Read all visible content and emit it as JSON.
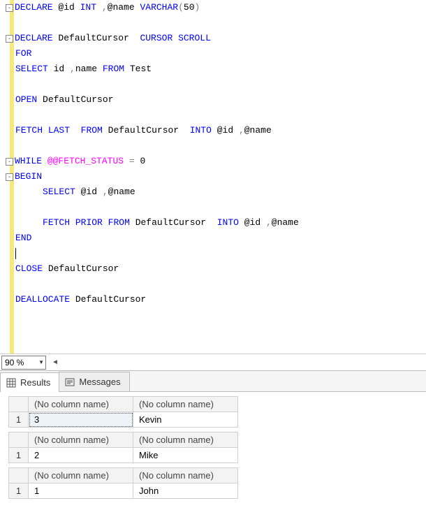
{
  "editor": {
    "lines": [
      {
        "fold": true,
        "tokens": [
          {
            "t": "DECLARE",
            "c": "kw"
          },
          {
            "t": " @id "
          },
          {
            "t": "INT",
            "c": "kw"
          },
          {
            "t": " "
          },
          {
            "t": ",",
            "c": "gray"
          },
          {
            "t": "@name "
          },
          {
            "t": "VARCHAR",
            "c": "kw"
          },
          {
            "t": "(",
            "c": "gray"
          },
          {
            "t": "50"
          },
          {
            "t": ")",
            "c": "gray"
          }
        ]
      },
      {
        "tokens": []
      },
      {
        "fold": true,
        "tokens": [
          {
            "t": "DECLARE",
            "c": "kw"
          },
          {
            "t": " DefaultCursor  "
          },
          {
            "t": "CURSOR",
            "c": "kw"
          },
          {
            "t": " "
          },
          {
            "t": "SCROLL",
            "c": "kw"
          }
        ]
      },
      {
        "tokens": [
          {
            "t": "FOR",
            "c": "kw"
          }
        ]
      },
      {
        "tokens": [
          {
            "t": "SELECT",
            "c": "kw"
          },
          {
            "t": " id "
          },
          {
            "t": ",",
            "c": "gray"
          },
          {
            "t": "name "
          },
          {
            "t": "FROM",
            "c": "kw"
          },
          {
            "t": " Test"
          }
        ]
      },
      {
        "tokens": []
      },
      {
        "tokens": [
          {
            "t": "OPEN",
            "c": "kw"
          },
          {
            "t": " DefaultCursor"
          }
        ]
      },
      {
        "tokens": []
      },
      {
        "tokens": [
          {
            "t": "FETCH",
            "c": "kw"
          },
          {
            "t": " "
          },
          {
            "t": "LAST",
            "c": "kw"
          },
          {
            "t": "  "
          },
          {
            "t": "FROM",
            "c": "kw"
          },
          {
            "t": " DefaultCursor  "
          },
          {
            "t": "INTO",
            "c": "kw"
          },
          {
            "t": " @id "
          },
          {
            "t": ",",
            "c": "gray"
          },
          {
            "t": "@name"
          }
        ]
      },
      {
        "tokens": []
      },
      {
        "fold": true,
        "tokens": [
          {
            "t": "WHILE",
            "c": "kw"
          },
          {
            "t": " "
          },
          {
            "t": "@@FETCH_STATUS",
            "c": "func"
          },
          {
            "t": " "
          },
          {
            "t": "=",
            "c": "gray"
          },
          {
            "t": " 0"
          }
        ]
      },
      {
        "fold": true,
        "tokens": [
          {
            "t": "BEGIN",
            "c": "kw"
          }
        ]
      },
      {
        "tokens": [
          {
            "t": "     "
          },
          {
            "t": "SELECT",
            "c": "kw"
          },
          {
            "t": " @id "
          },
          {
            "t": ",",
            "c": "gray"
          },
          {
            "t": "@name"
          }
        ]
      },
      {
        "tokens": []
      },
      {
        "tokens": [
          {
            "t": "     "
          },
          {
            "t": "FETCH",
            "c": "kw"
          },
          {
            "t": " "
          },
          {
            "t": "PRIOR",
            "c": "kw"
          },
          {
            "t": " "
          },
          {
            "t": "FROM",
            "c": "kw"
          },
          {
            "t": " DefaultCursor  "
          },
          {
            "t": "INTO",
            "c": "kw"
          },
          {
            "t": " @id "
          },
          {
            "t": ",",
            "c": "gray"
          },
          {
            "t": "@name"
          }
        ]
      },
      {
        "tokens": [
          {
            "t": "END",
            "c": "kw"
          }
        ]
      },
      {
        "caret": true,
        "tokens": []
      },
      {
        "tokens": [
          {
            "t": "CLOSE",
            "c": "kw"
          },
          {
            "t": " DefaultCursor"
          }
        ]
      },
      {
        "tokens": []
      },
      {
        "tokens": [
          {
            "t": "DEALLOCATE",
            "c": "kw"
          },
          {
            "t": " DefaultCursor"
          }
        ]
      }
    ]
  },
  "zoom": {
    "value": "90 %"
  },
  "tabs": {
    "results": "Results",
    "messages": "Messages"
  },
  "grids": {
    "col_header": "(No column name)",
    "sets": [
      {
        "row_num": "1",
        "c1": "3",
        "c2": "Kevin"
      },
      {
        "row_num": "1",
        "c1": "2",
        "c2": "Mike"
      },
      {
        "row_num": "1",
        "c1": "1",
        "c2": "John"
      }
    ]
  },
  "chart_data": {
    "type": "table",
    "title": "Cursor fetch results",
    "columns": [
      "(No column name)",
      "(No column name)"
    ],
    "result_sets": [
      {
        "rows": [
          [
            "3",
            "Kevin"
          ]
        ]
      },
      {
        "rows": [
          [
            "2",
            "Mike"
          ]
        ]
      },
      {
        "rows": [
          [
            "1",
            "John"
          ]
        ]
      }
    ]
  }
}
